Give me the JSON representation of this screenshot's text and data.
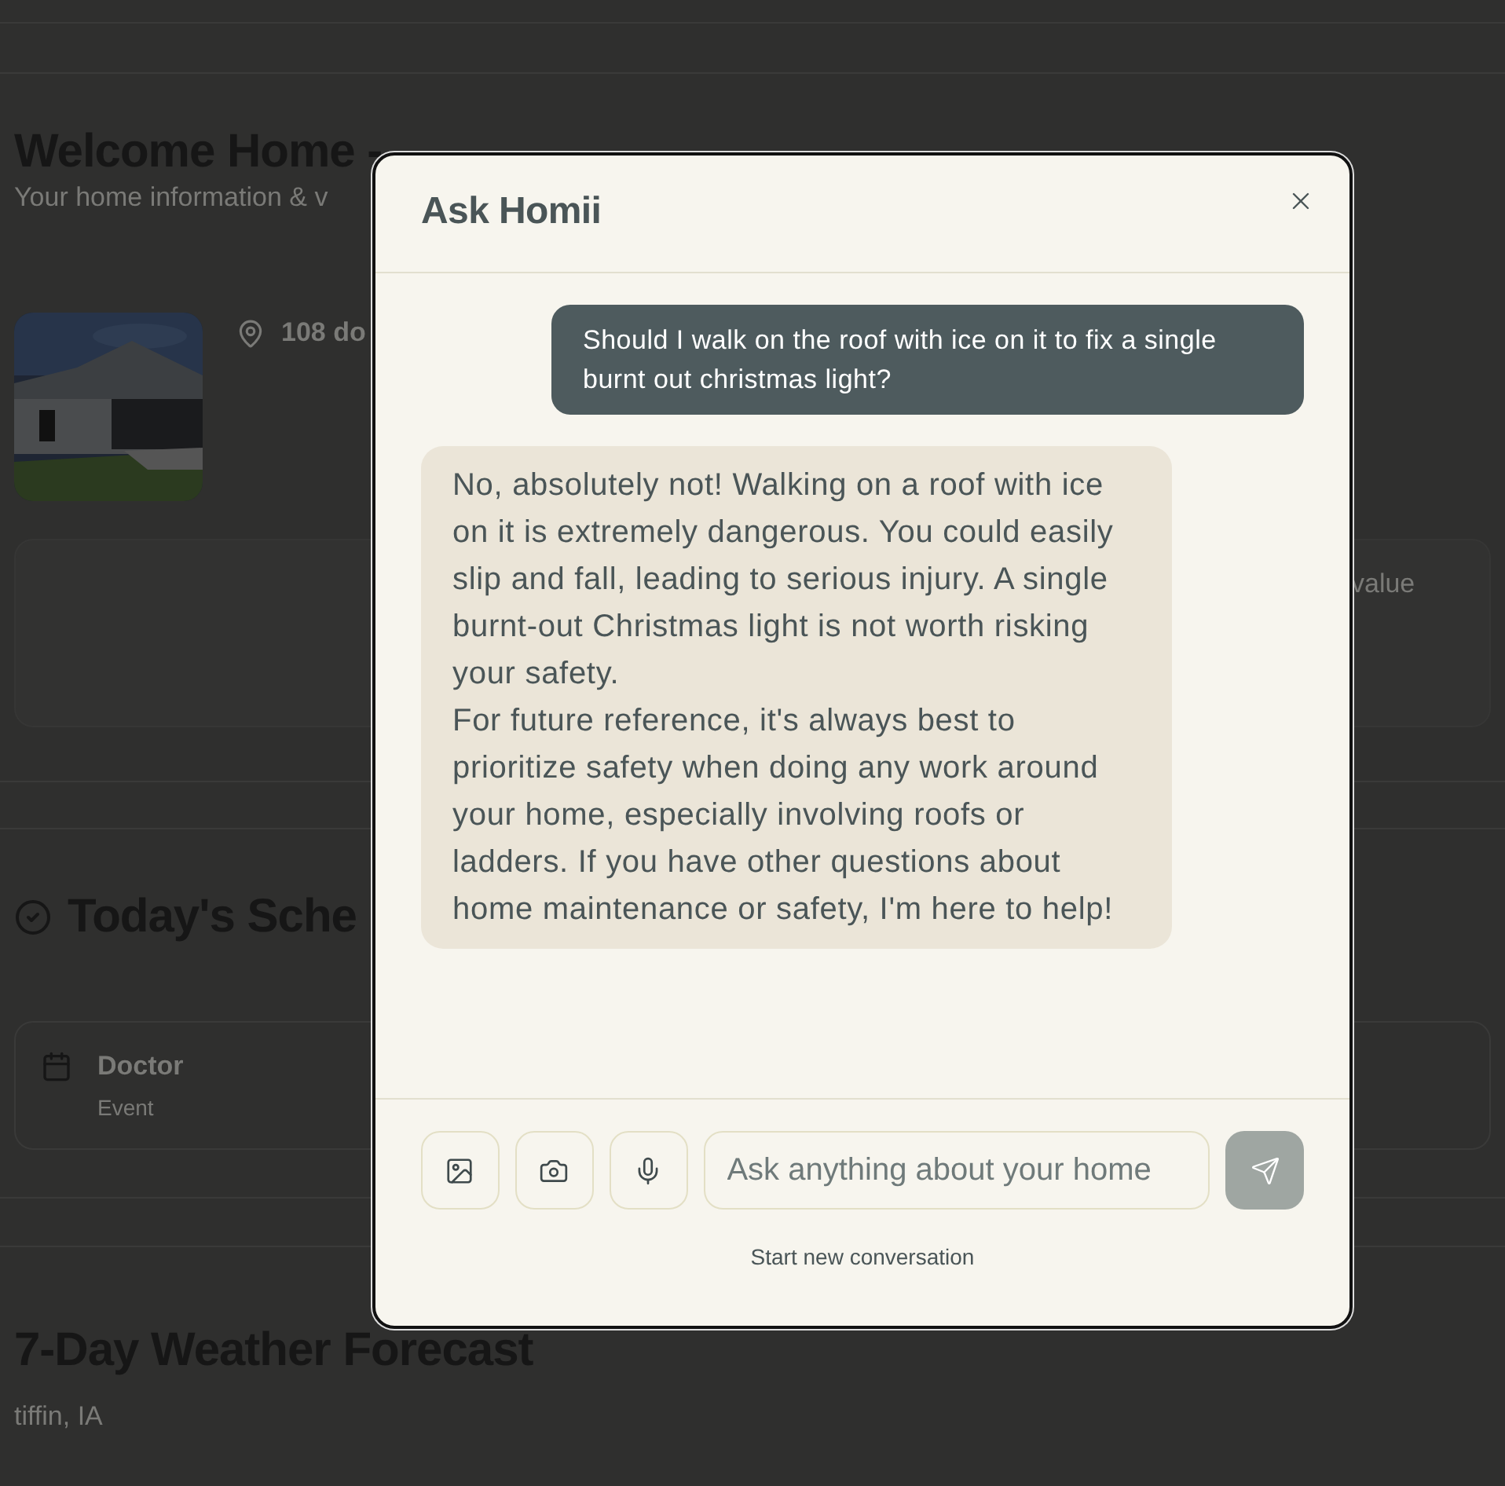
{
  "page": {
    "title": "Welcome Home -",
    "subtitle": "Your home information & v",
    "address": "108 do",
    "value_label": "value",
    "schedule": {
      "title": "Today's Sche",
      "events": [
        {
          "name": "Doctor",
          "type": "Event"
        }
      ]
    },
    "weather": {
      "title": "7-Day Weather Forecast",
      "location": "tiffin, IA"
    }
  },
  "dialog": {
    "title": "Ask Homii",
    "messages": [
      {
        "kind": "user",
        "paragraphs": [
          "Should I walk on the roof with ice on it to fix a single burnt out christmas light?"
        ]
      },
      {
        "kind": "assistant",
        "paragraphs": [
          "No, absolutely not! Walking on a roof with ice on it is extremely dangerous. You could easily slip and fall, leading to serious injury. A single burnt-out Christmas light is not worth risking your safety.",
          "For future reference, it's always best to prioritize safety when doing any work around your home, especially involving roofs or ladders. If you have other questions about home maintenance or safety, I'm here to help!"
        ]
      }
    ],
    "input": {
      "placeholder": "Ask anything about your home"
    },
    "send_disabled": true,
    "footer_link": "Start new conversation"
  }
}
